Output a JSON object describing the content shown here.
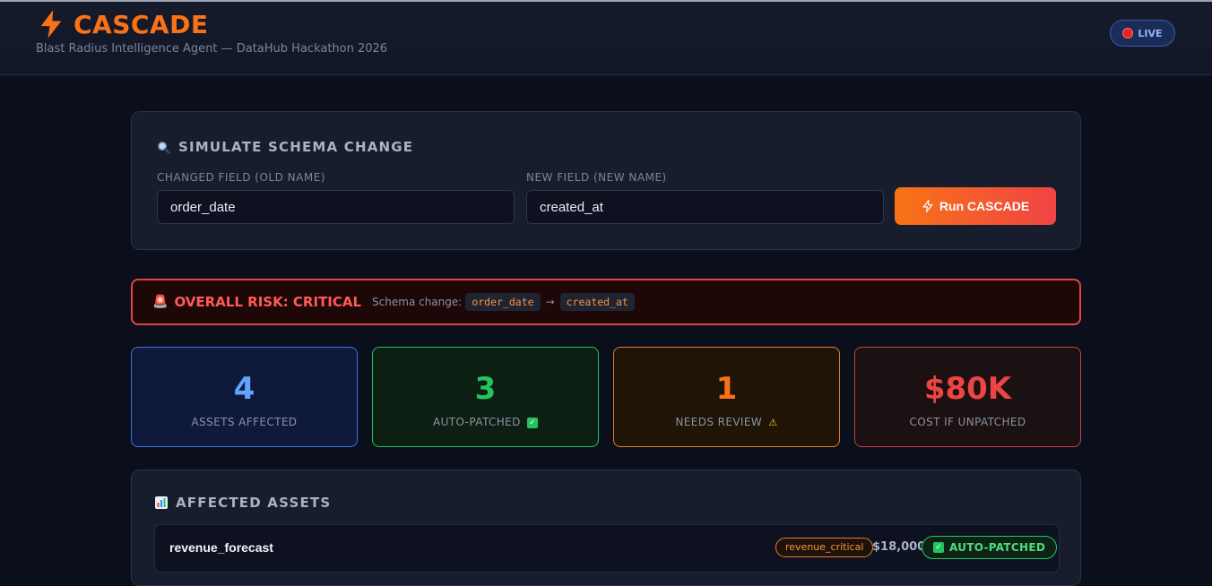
{
  "header": {
    "title": "CASCADE",
    "subtitle": "Blast Radius Intelligence Agent — DataHub Hackathon 2026",
    "status_badge": "LIVE"
  },
  "simulate": {
    "title": "SIMULATE SCHEMA CHANGE",
    "old_field_label": "CHANGED FIELD (OLD NAME)",
    "old_field_value": "order_date",
    "new_field_label": "NEW FIELD (NEW NAME)",
    "new_field_value": "created_at",
    "run_button": "Run CASCADE"
  },
  "risk": {
    "label": "OVERALL RISK: CRITICAL",
    "schema_change_label": "Schema change:",
    "from": "order_date",
    "arrow": "→",
    "to": "created_at"
  },
  "stats": [
    {
      "value": "4",
      "label": "ASSETS AFFECTED",
      "color": "#60a5fa"
    },
    {
      "value": "3",
      "label": "AUTO-PATCHED",
      "color": "#22c55e"
    },
    {
      "value": "1",
      "label": "NEEDS REVIEW",
      "color": "#f97316"
    },
    {
      "value": "$80K",
      "label": "COST IF UNPATCHED",
      "color": "#ef4444"
    }
  ],
  "assets": {
    "title": "AFFECTED ASSETS",
    "rows": [
      {
        "name": "revenue_forecast",
        "tag": "revenue_critical",
        "cost": "$18,000",
        "status": "AUTO-PATCHED"
      }
    ]
  },
  "colors": {
    "accent": "#f97316",
    "critical": "#ef4444",
    "success": "#22c55e",
    "info": "#60a5fa"
  }
}
